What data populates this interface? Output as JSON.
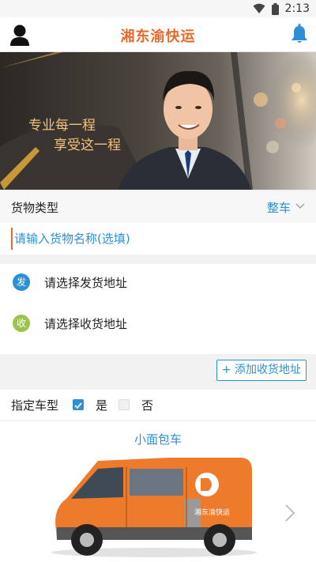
{
  "status_bar": {
    "time": "2:13"
  },
  "header": {
    "title": "湘东渝快运"
  },
  "banner": {
    "slogan_line1": "专业每一程",
    "slogan_line2": "享受这一程"
  },
  "cargo_type": {
    "label": "货物类型",
    "value": "整车"
  },
  "cargo_name": {
    "placeholder": "请输入货物名称(选填)"
  },
  "addresses": {
    "ship": {
      "badge": "发",
      "text": "请选择发货地址",
      "color": "#2d8fd5"
    },
    "receive": {
      "badge": "收",
      "text": "请选择收货地址",
      "color": "#9cc34a"
    }
  },
  "add_receive_button": "+ 添加收货地址",
  "vehicle_type": {
    "label": "指定车型",
    "yes": "是",
    "no": "否",
    "selected": "是"
  },
  "vehicle": {
    "name": "小面包车",
    "brand_text": "湘东渝快运"
  },
  "colors": {
    "accent_orange": "#e8692a",
    "accent_blue": "#2d8fd5"
  }
}
